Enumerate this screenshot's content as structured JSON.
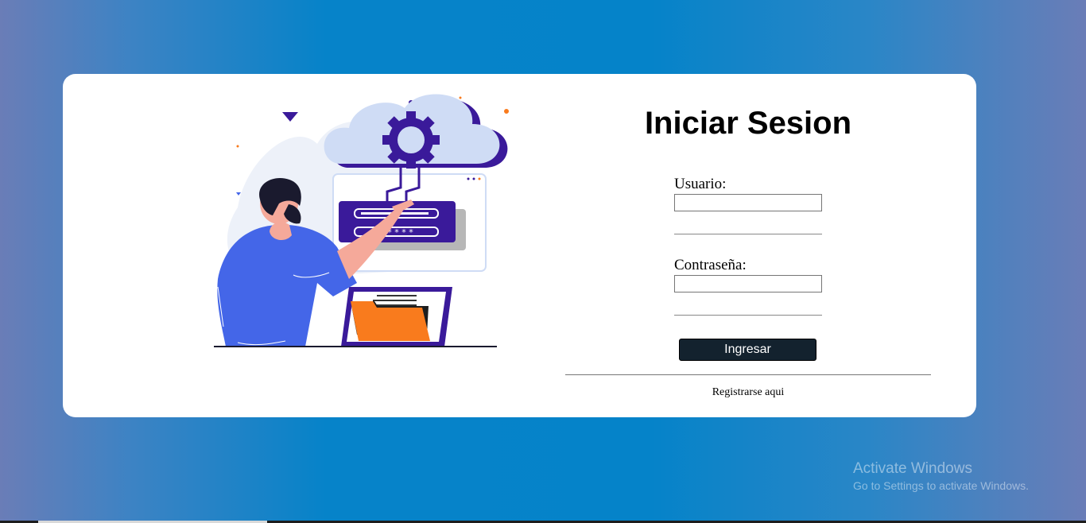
{
  "login": {
    "title": "Iniciar Sesion",
    "username_label": "Usuario:",
    "username_value": "",
    "password_label": "Contraseña:",
    "password_value": "",
    "submit_label": "Ingresar",
    "register_link": "Registrarse aqui"
  },
  "illustration": {
    "icon": "cloud-login-illustration",
    "password_mask": "* * * * *"
  },
  "watermark": {
    "title": "Activate Windows",
    "subtitle": "Go to Settings to activate Windows."
  },
  "colors": {
    "background_accent": "#0583c9",
    "card": "#ffffff",
    "button": "#13222e",
    "illustration_purple": "#3a1a9a",
    "illustration_orange": "#f97b1d",
    "illustration_blue": "#4466e8"
  }
}
